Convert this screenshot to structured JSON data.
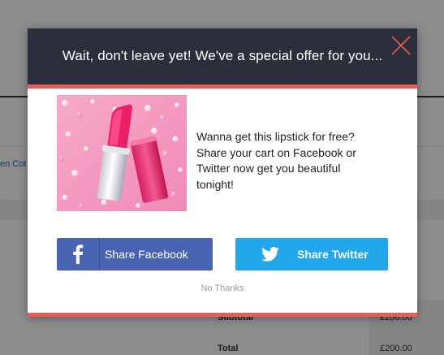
{
  "background": {
    "link_text": "en Cot",
    "subtotal_label": "Subtotal",
    "subtotal_value": "£200.00",
    "total_label": "Total",
    "total_value": "£200.00"
  },
  "modal": {
    "title": "Wait, don't leave yet! We've a special offer for you...",
    "close_icon": "close-icon",
    "image_subject": "lipstick",
    "offer_lines": [
      "Wanna get this lipstick for free?",
      "Share your cart on Facebook or",
      "Twitter now get you beautiful",
      "tonight!"
    ],
    "facebook_button": {
      "label": "Share Facebook",
      "icon": "facebook-icon",
      "color": "#4863b0"
    },
    "twitter_button": {
      "label": "Share Twitter",
      "icon": "twitter-icon",
      "color": "#22a8ea"
    },
    "no_thanks": "No Thanks",
    "accent_color": "#ee5a55",
    "header_color": "#2b2f3b"
  }
}
